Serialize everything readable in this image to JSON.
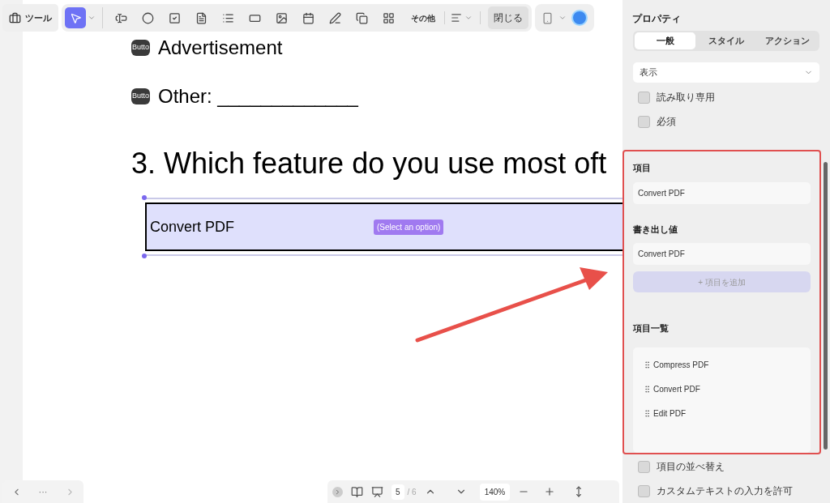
{
  "toolbar": {
    "tools_button": "ツール",
    "tools": [
      {
        "kind": "pointer",
        "selected": true
      },
      {
        "kind": "text-field",
        "selected": false
      },
      {
        "kind": "radio",
        "selected": false
      },
      {
        "kind": "checkbox",
        "selected": false
      },
      {
        "kind": "combo",
        "selected": false
      },
      {
        "kind": "list",
        "selected": false
      },
      {
        "kind": "button",
        "selected": false
      },
      {
        "kind": "image",
        "selected": false
      },
      {
        "kind": "date",
        "selected": false
      },
      {
        "kind": "signature",
        "selected": false
      },
      {
        "kind": "copy",
        "selected": false
      },
      {
        "kind": "grid",
        "selected": false
      }
    ],
    "more": "その他",
    "close": "閉じる"
  },
  "document": {
    "options": [
      {
        "thumb": "Butto",
        "label": "Advertisement"
      },
      {
        "thumb": "Butto",
        "label": "Other: _____________"
      }
    ],
    "question": "3. Which feature do you use most oft",
    "dropdown": {
      "value": "Convert PDF",
      "hint": "(Select an option)"
    }
  },
  "panel": {
    "title": "プロパティ",
    "tabs": [
      {
        "label": "一般",
        "selected": true
      },
      {
        "label": "スタイル",
        "selected": false
      },
      {
        "label": "アクション",
        "selected": false
      }
    ],
    "visibility": "表示",
    "checkboxes": [
      {
        "label": "読み取り専用",
        "checked": false
      },
      {
        "label": "必須",
        "checked": false
      }
    ],
    "item_label": "項目",
    "item_value": "Convert PDF",
    "export_label": "書き出し値",
    "export_value": "Convert PDF",
    "add_button": "+ 項目を追加",
    "list_label": "項目一覧",
    "list_items": [
      "Compress PDF",
      "Convert PDF",
      "Edit PDF"
    ],
    "bottom_checkboxes": [
      {
        "label": "項目の並べ替え",
        "checked": false
      },
      {
        "label": "カスタムテキストの入力を許可",
        "checked": false
      }
    ]
  },
  "page_nav": {
    "more": "···",
    "page": "5",
    "total": "/ 6",
    "zoom": "140%"
  }
}
